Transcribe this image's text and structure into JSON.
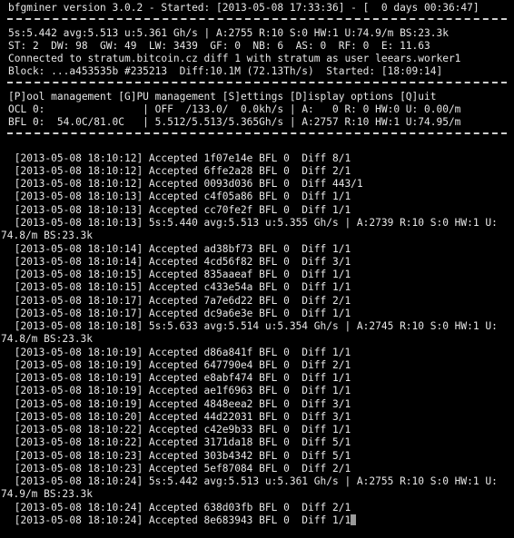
{
  "terminal": {
    "header": [
      "bfgminer version 3.0.2 - Started: [2013-05-08 17:33:36] - [  0 days 00:36:47]"
    ],
    "status": [
      "5s:5.442 avg:5.513 u:5.361 Gh/s | A:2755 R:10 S:0 HW:1 U:74.9/m BS:23.3k",
      "ST: 2  DW: 98  GW: 49  LW: 3439  GF: 0  NB: 6  AS: 0  RF: 0  E: 11.63",
      "Connected to stratum.bitcoin.cz diff 1 with stratum as user leears.worker1",
      "Block: ...a453535b #235213  Diff:10.1M (72.13Th/s)  Started: [18:09:14]"
    ],
    "menu": [
      "[P]ool management [G]PU management [S]ettings [D]isplay options [Q]uit",
      "OCL 0:                | OFF  /133.0/  0.0kh/s | A:   0 R: 0 HW:0 U: 0.00/m",
      "BFL 0:  54.0C/81.0C   | 5.512/5.513/5.365Gh/s | A:2757 R:10 HW:1 U:74.95/m"
    ],
    "log": [
      " [2013-05-08 18:10:12] Accepted 1f07e14e BFL 0  Diff 8/1",
      " [2013-05-08 18:10:12] Accepted 6ffe2a28 BFL 0  Diff 2/1",
      " [2013-05-08 18:10:12] Accepted 0093d036 BFL 0  Diff 443/1",
      " [2013-05-08 18:10:13] Accepted c4f05a86 BFL 0  Diff 1/1",
      " [2013-05-08 18:10:13] Accepted cc70fe2f BFL 0  Diff 1/1",
      " [2013-05-08 18:10:13] 5s:5.440 avg:5.513 u:5.355 Gh/s | A:2739 R:10 S:0 HW:1 U:",
      "74.8/m BS:23.3k",
      " [2013-05-08 18:10:14] Accepted ad38bf73 BFL 0  Diff 1/1",
      " [2013-05-08 18:10:14] Accepted 4cd56f82 BFL 0  Diff 3/1",
      " [2013-05-08 18:10:15] Accepted 835aaeaf BFL 0  Diff 1/1",
      " [2013-05-08 18:10:15] Accepted c433e54a BFL 0  Diff 1/1",
      " [2013-05-08 18:10:17] Accepted 7a7e6d22 BFL 0  Diff 2/1",
      " [2013-05-08 18:10:17] Accepted dc9a6e3e BFL 0  Diff 1/1",
      " [2013-05-08 18:10:18] 5s:5.633 avg:5.514 u:5.354 Gh/s | A:2745 R:10 S:0 HW:1 U:",
      "74.8/m BS:23.3k",
      " [2013-05-08 18:10:19] Accepted d86a841f BFL 0  Diff 1/1",
      " [2013-05-08 18:10:19] Accepted 647790e4 BFL 0  Diff 2/1",
      " [2013-05-08 18:10:19] Accepted e8abf474 BFL 0  Diff 1/1",
      " [2013-05-08 18:10:19] Accepted ae1f6963 BFL 0  Diff 1/1",
      " [2013-05-08 18:10:19] Accepted 4848eea2 BFL 0  Diff 3/1",
      " [2013-05-08 18:10:20] Accepted 44d22031 BFL 0  Diff 3/1",
      " [2013-05-08 18:10:22] Accepted c42e9b33 BFL 0  Diff 1/1",
      " [2013-05-08 18:10:22] Accepted 3171da18 BFL 0  Diff 5/1",
      " [2013-05-08 18:10:23] Accepted 303b4342 BFL 0  Diff 5/1",
      " [2013-05-08 18:10:23] Accepted 5ef87084 BFL 0  Diff 2/1",
      " [2013-05-08 18:10:24] 5s:5.442 avg:5.513 u:5.361 Gh/s | A:2755 R:10 S:0 HW:1 U:",
      "74.9/m BS:23.3k",
      " [2013-05-08 18:10:24] Accepted 638d03fb BFL 0  Diff 2/1",
      " [2013-05-08 18:10:24] Accepted 8e683943 BFL 0  Diff 1/1"
    ]
  }
}
